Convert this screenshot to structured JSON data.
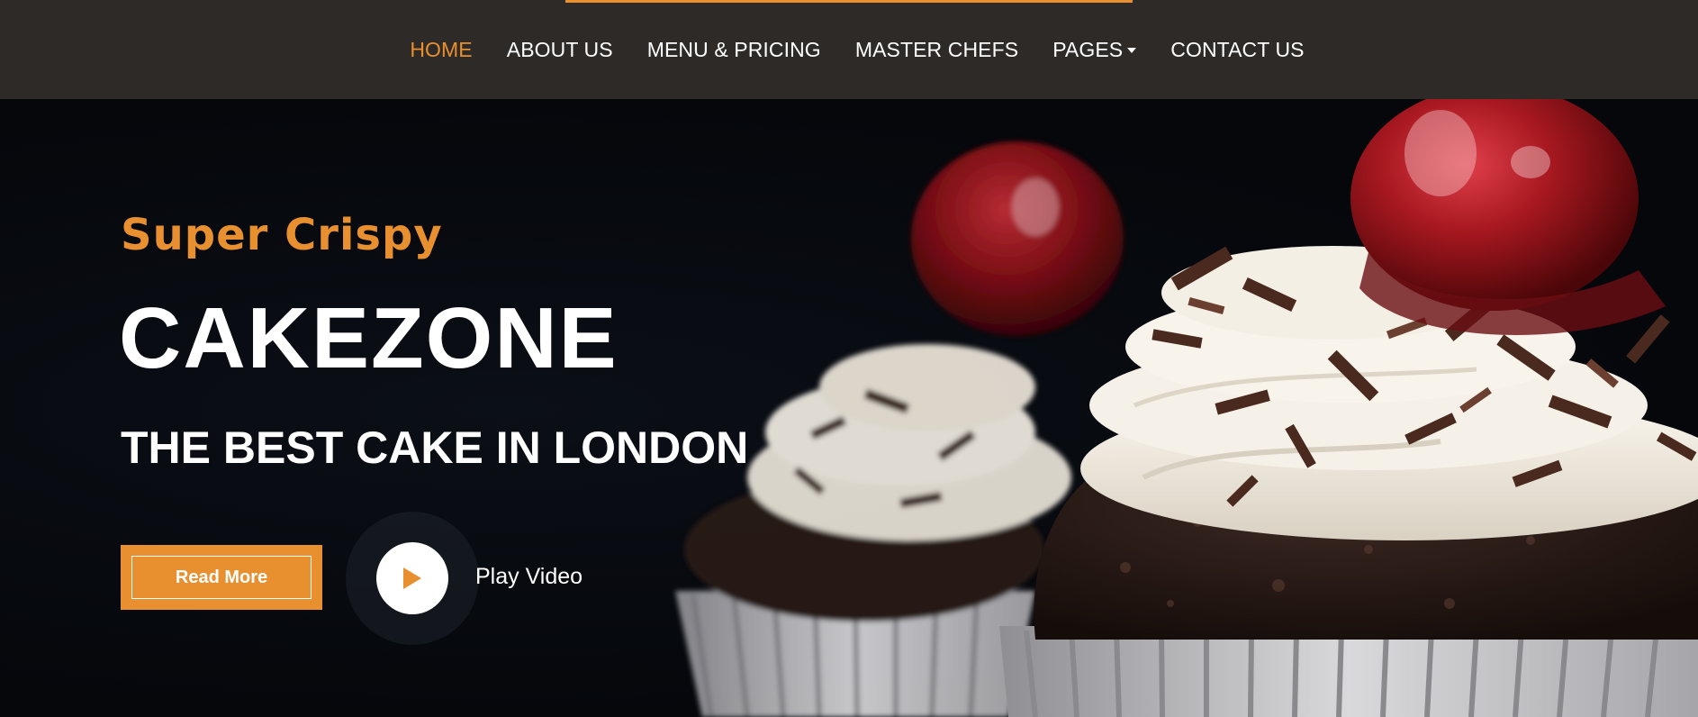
{
  "nav": {
    "items": [
      {
        "label": "HOME",
        "active": true
      },
      {
        "label": "ABOUT US"
      },
      {
        "label": "MENU & PRICING"
      },
      {
        "label": "MASTER CHEFS"
      },
      {
        "label": "PAGES",
        "dropdown": true
      },
      {
        "label": "CONTACT US"
      }
    ]
  },
  "hero": {
    "tagline": "Super Crispy",
    "brand": "CAKEZONE",
    "headline": "THE BEST CAKE IN LONDON",
    "read_more_label": "Read More",
    "play_video_label": "Play Video",
    "play_icon": "play-icon",
    "image_subject": "chocolate cupcakes with whipped cream, chocolate shavings and cherries"
  },
  "colors": {
    "accent": "#e8902f",
    "navbar_bg": "#2e2a27",
    "hero_bg": "#05070b",
    "text": "#ffffff"
  }
}
